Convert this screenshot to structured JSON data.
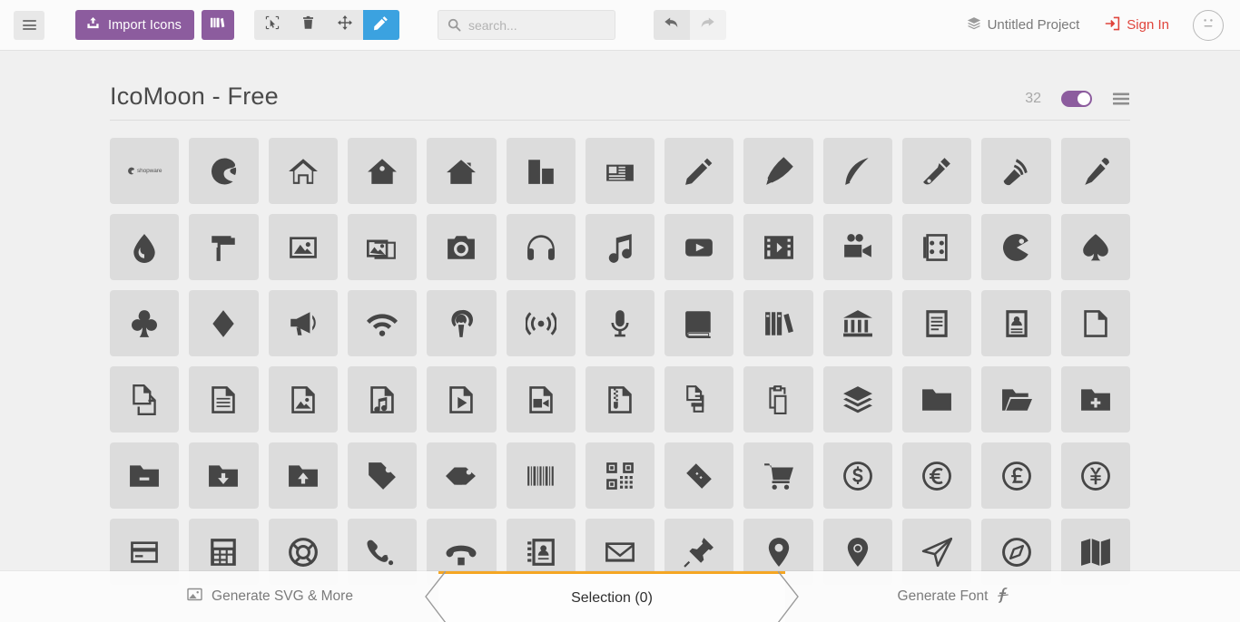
{
  "toolbar": {
    "menu_icon": "hamburger-menu-icon",
    "import_label": "Import Icons",
    "import_icon": "upload-icon",
    "library_icon": "library-books-icon",
    "tools": [
      {
        "name": "select-tool",
        "icon": "cursor-select-icon",
        "active": false
      },
      {
        "name": "delete-tool",
        "icon": "trash-icon",
        "active": false
      },
      {
        "name": "move-tool",
        "icon": "move-arrows-icon",
        "active": false
      },
      {
        "name": "edit-tool",
        "icon": "pencil-icon",
        "active": true
      }
    ],
    "search": {
      "value": "",
      "placeholder": "search...",
      "icon": "search-icon"
    },
    "undo_icon": "undo-arrow-icon",
    "redo_icon": "redo-arrow-icon",
    "project_label": "Untitled Project",
    "project_icon": "stack-layers-icon",
    "signin_label": "Sign In",
    "signin_icon": "login-door-icon",
    "avatar_icon": "neutral-face-icon"
  },
  "colors": {
    "purple": "#8c5c9e",
    "blue": "#3ba2e0",
    "red": "#e0453c",
    "orange": "#f5a623",
    "tile_bg": "#dcdcdc",
    "page_bg": "#f0f0f0"
  },
  "set": {
    "title": "IcoMoon - Free",
    "count": "32",
    "toggle_on": true,
    "toggle_name": "set-visibility-toggle",
    "menu_icon": "set-menu-icon"
  },
  "icons": [
    {
      "name": "shopware-wordmark-icon",
      "glyph": "shopware-text"
    },
    {
      "name": "shopware-icon",
      "glyph": "shopware"
    },
    {
      "name": "home-icon",
      "glyph": "home"
    },
    {
      "name": "home2-icon",
      "glyph": "home2"
    },
    {
      "name": "home3-icon",
      "glyph": "home3"
    },
    {
      "name": "office-icon",
      "glyph": "office"
    },
    {
      "name": "newspaper-icon",
      "glyph": "newspaper"
    },
    {
      "name": "pencil-icon",
      "glyph": "pencil"
    },
    {
      "name": "pencil2-icon",
      "glyph": "pencil2"
    },
    {
      "name": "quill-icon",
      "glyph": "quill"
    },
    {
      "name": "pen-icon",
      "glyph": "pen"
    },
    {
      "name": "blog-icon",
      "glyph": "blog"
    },
    {
      "name": "eyedropper-icon",
      "glyph": "eyedropper"
    },
    {
      "name": "droplet-icon",
      "glyph": "droplet"
    },
    {
      "name": "paint-format-icon",
      "glyph": "paint-format"
    },
    {
      "name": "image-icon",
      "glyph": "image"
    },
    {
      "name": "images-icon",
      "glyph": "images"
    },
    {
      "name": "camera-icon",
      "glyph": "camera"
    },
    {
      "name": "headphones-icon",
      "glyph": "headphones"
    },
    {
      "name": "music-icon",
      "glyph": "music"
    },
    {
      "name": "play-icon",
      "glyph": "play"
    },
    {
      "name": "film-icon",
      "glyph": "film"
    },
    {
      "name": "video-camera-icon",
      "glyph": "video-camera"
    },
    {
      "name": "dice-icon",
      "glyph": "dice"
    },
    {
      "name": "pacman-icon",
      "glyph": "pacman"
    },
    {
      "name": "spades-icon",
      "glyph": "spades"
    },
    {
      "name": "clubs-icon",
      "glyph": "clubs"
    },
    {
      "name": "diamonds-icon",
      "glyph": "diamonds"
    },
    {
      "name": "bullhorn-icon",
      "glyph": "bullhorn"
    },
    {
      "name": "connection-icon",
      "glyph": "connection"
    },
    {
      "name": "podcast-icon",
      "glyph": "podcast"
    },
    {
      "name": "feed-icon",
      "glyph": "feed"
    },
    {
      "name": "mic-icon",
      "glyph": "mic"
    },
    {
      "name": "book-icon",
      "glyph": "book"
    },
    {
      "name": "books-icon",
      "glyph": "books"
    },
    {
      "name": "library-icon",
      "glyph": "library"
    },
    {
      "name": "file-text-icon",
      "glyph": "file-text"
    },
    {
      "name": "profile-icon",
      "glyph": "profile"
    },
    {
      "name": "file-empty-icon",
      "glyph": "file-empty"
    },
    {
      "name": "files-empty-icon",
      "glyph": "files-empty"
    },
    {
      "name": "file-text2-icon",
      "glyph": "file-text2"
    },
    {
      "name": "file-picture-icon",
      "glyph": "file-picture"
    },
    {
      "name": "file-music-icon",
      "glyph": "file-music"
    },
    {
      "name": "file-play-icon",
      "glyph": "file-play"
    },
    {
      "name": "file-video-icon",
      "glyph": "file-video"
    },
    {
      "name": "file-zip-icon",
      "glyph": "file-zip"
    },
    {
      "name": "copy-icon",
      "glyph": "copy"
    },
    {
      "name": "paste-icon",
      "glyph": "paste"
    },
    {
      "name": "stack-icon",
      "glyph": "stack"
    },
    {
      "name": "folder-icon",
      "glyph": "folder"
    },
    {
      "name": "folder-open-icon",
      "glyph": "folder-open"
    },
    {
      "name": "folder-plus-icon",
      "glyph": "folder-plus"
    },
    {
      "name": "folder-minus-icon",
      "glyph": "folder-minus"
    },
    {
      "name": "folder-download-icon",
      "glyph": "folder-download"
    },
    {
      "name": "folder-upload-icon",
      "glyph": "folder-upload"
    },
    {
      "name": "price-tag-icon",
      "glyph": "price-tag"
    },
    {
      "name": "price-tags-icon",
      "glyph": "price-tags"
    },
    {
      "name": "barcode-icon",
      "glyph": "barcode"
    },
    {
      "name": "qrcode-icon",
      "glyph": "qrcode"
    },
    {
      "name": "ticket-icon",
      "glyph": "ticket"
    },
    {
      "name": "cart-icon",
      "glyph": "cart"
    },
    {
      "name": "coin-dollar-icon",
      "glyph": "coin-dollar"
    },
    {
      "name": "coin-euro-icon",
      "glyph": "coin-euro"
    },
    {
      "name": "coin-pound-icon",
      "glyph": "coin-pound"
    },
    {
      "name": "coin-yen-icon",
      "glyph": "coin-yen"
    },
    {
      "name": "credit-card-icon",
      "glyph": "credit-card"
    },
    {
      "name": "calculator-icon",
      "glyph": "calculator"
    },
    {
      "name": "lifebuoy-icon",
      "glyph": "lifebuoy"
    },
    {
      "name": "phone-icon",
      "glyph": "phone"
    },
    {
      "name": "phone-hang-up-icon",
      "glyph": "phone-hang-up"
    },
    {
      "name": "address-book-icon",
      "glyph": "address-book"
    },
    {
      "name": "envelop-icon",
      "glyph": "envelop"
    },
    {
      "name": "pushpin-icon",
      "glyph": "pushpin"
    },
    {
      "name": "location-icon",
      "glyph": "location"
    },
    {
      "name": "location2-icon",
      "glyph": "location2"
    },
    {
      "name": "compass-icon",
      "glyph": "compass"
    },
    {
      "name": "compass2-icon",
      "glyph": "compass2"
    },
    {
      "name": "map-icon",
      "glyph": "map"
    }
  ],
  "bottom": {
    "generate_svg_label": "Generate SVG & More",
    "generate_svg_icon": "image-icon",
    "selection_label": "Selection (0)",
    "generate_font_label": "Generate Font",
    "generate_font_icon": "font-f-icon"
  }
}
